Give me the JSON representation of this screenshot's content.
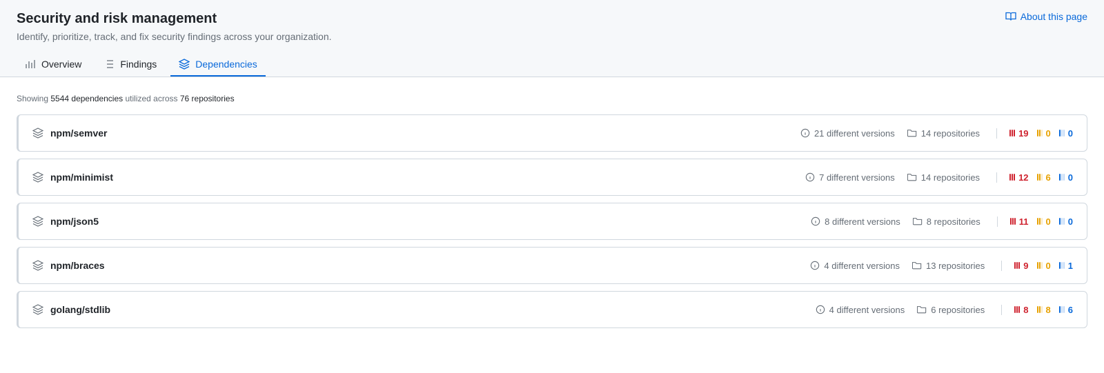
{
  "header": {
    "title": "Security and risk management",
    "subtitle": "Identify, prioritize, track, and fix security findings across your organization.",
    "about_link": "About this page"
  },
  "tabs": [
    {
      "label": "Overview",
      "active": false
    },
    {
      "label": "Findings",
      "active": false
    },
    {
      "label": "Dependencies",
      "active": true
    }
  ],
  "summary": {
    "prefix": "Showing",
    "dep_count": "5544 dependencies",
    "middle": "utilized across",
    "repo_count": "76 repositories"
  },
  "dependencies": [
    {
      "name": "npm/semver",
      "versions": "21 different versions",
      "repos": "14 repositories",
      "sev_high": "19",
      "sev_med": "0",
      "sev_low": "0"
    },
    {
      "name": "npm/minimist",
      "versions": "7 different versions",
      "repos": "14 repositories",
      "sev_high": "12",
      "sev_med": "6",
      "sev_low": "0"
    },
    {
      "name": "npm/json5",
      "versions": "8 different versions",
      "repos": "8 repositories",
      "sev_high": "11",
      "sev_med": "0",
      "sev_low": "0"
    },
    {
      "name": "npm/braces",
      "versions": "4 different versions",
      "repos": "13 repositories",
      "sev_high": "9",
      "sev_med": "0",
      "sev_low": "1"
    },
    {
      "name": "golang/stdlib",
      "versions": "4 different versions",
      "repos": "6 repositories",
      "sev_high": "8",
      "sev_med": "8",
      "sev_low": "6"
    }
  ]
}
